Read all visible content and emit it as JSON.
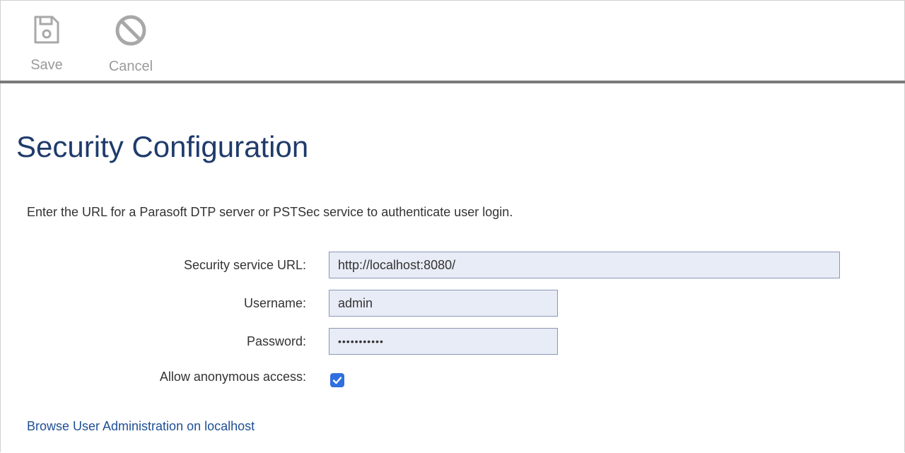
{
  "toolbar": {
    "save_label": "Save",
    "save_icon": "save-floppy-icon",
    "cancel_label": "Cancel",
    "cancel_icon": "cancel-circle-slash-icon"
  },
  "page": {
    "title": "Security Configuration",
    "intro": "Enter the URL for a Parasoft DTP server or PSTSec service to authenticate user login."
  },
  "form": {
    "url_label": "Security service URL:",
    "url_value": "http://localhost:8080/",
    "username_label": "Username:",
    "username_value": "admin",
    "password_label": "Password:",
    "password_value": "•••••••••••",
    "anonymous_label": "Allow anonymous access:",
    "anonymous_checked": true
  },
  "links": {
    "admin_link": "Browse User Administration on localhost"
  },
  "colors": {
    "title": "#1f3b6b",
    "link": "#1f4f96",
    "checkbox": "#2f6fe0",
    "field_bg": "#e8ecf6",
    "toolbar_icon": "#9a9a9a"
  }
}
